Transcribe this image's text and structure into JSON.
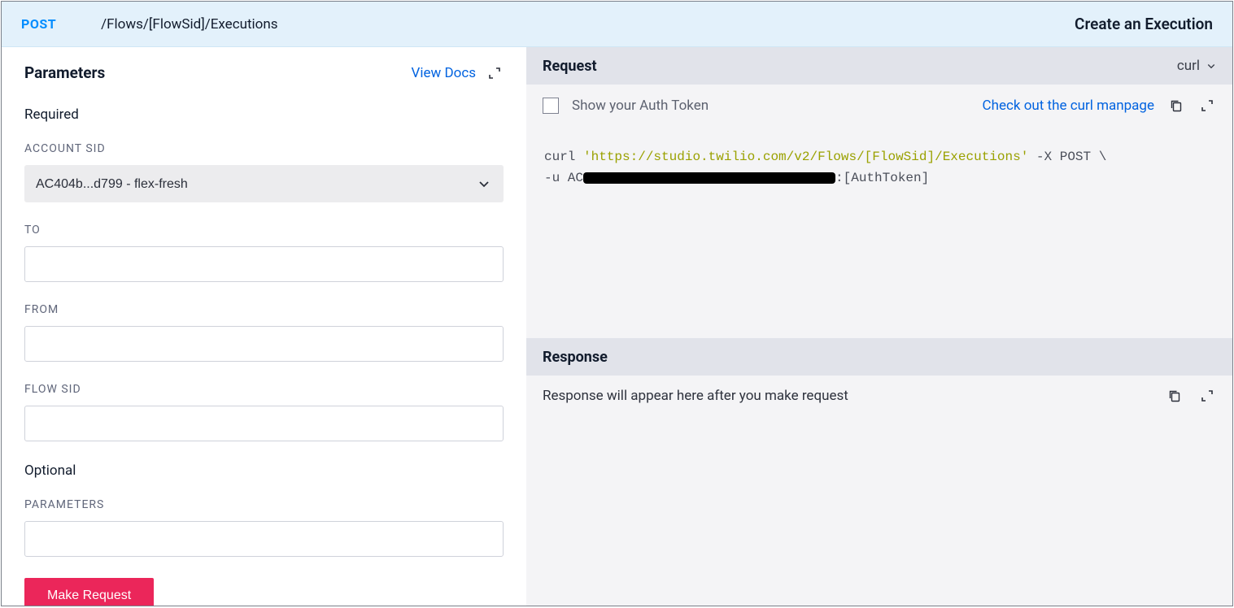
{
  "header": {
    "method": "POST",
    "path": "/Flows/[FlowSid]/Executions",
    "page_title": "Create an Execution"
  },
  "left": {
    "section_title": "Parameters",
    "view_docs": "View Docs",
    "required_label": "Required",
    "optional_label": "Optional",
    "fields": {
      "account_sid": {
        "label": "ACCOUNT SID",
        "selected": "AC404b...d799 - flex-fresh"
      },
      "to": {
        "label": "TO",
        "value": ""
      },
      "from": {
        "label": "FROM",
        "value": ""
      },
      "flow_sid": {
        "label": "FLOW SID",
        "value": ""
      },
      "parameters": {
        "label": "PARAMETERS",
        "value": ""
      }
    },
    "make_request": "Make Request"
  },
  "right": {
    "request_label": "Request",
    "lang_selected": "curl",
    "show_auth_label": "Show your Auth Token",
    "manpage_link": "Check out the curl manpage",
    "code": {
      "prefix1": "curl ",
      "url": "'https://studio.twilio.com/v2/Flows/[FlowSid]/Executions'",
      "suffix1": " -X POST \\",
      "line2_prefix": "-u AC",
      "line2_suffix": ":[AuthToken]"
    },
    "response_label": "Response",
    "response_placeholder": "Response will appear here after you make request"
  }
}
